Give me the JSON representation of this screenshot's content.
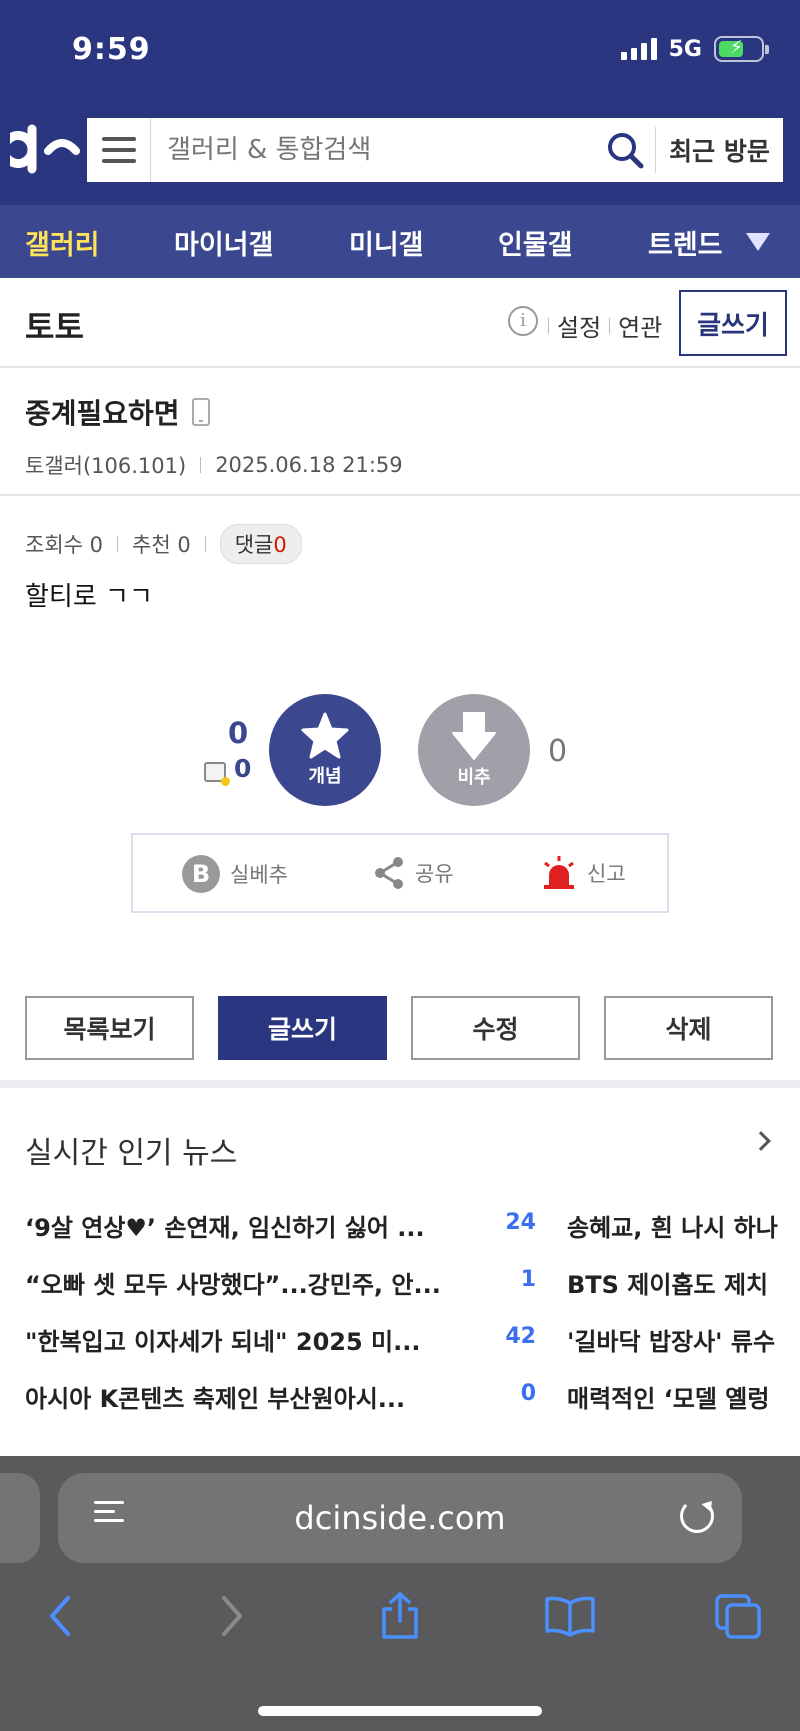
{
  "status": {
    "time": "9:59",
    "network": "5G"
  },
  "header": {
    "search_placeholder": "갤러리 & 통합검색",
    "recent_label": "최근 방문",
    "nav": [
      "갤러리",
      "마이너갤",
      "미니갤",
      "인물갤",
      "트렌드"
    ],
    "accent": "#2b3680",
    "active_color": "#ffe35a"
  },
  "gallery": {
    "name": "토토",
    "links": [
      "설정",
      "연관"
    ],
    "write_label": "글쓰기"
  },
  "post": {
    "title": "중계필요하면",
    "author": "토갤러(106.101)",
    "date": "2025.06.18 21:59",
    "views_label": "조회수 0",
    "recommend_label": "추천 0",
    "comment_label": "댓글",
    "comment_count": "0",
    "body": "할티로 ㄱㄱ"
  },
  "vote": {
    "up_count": "0",
    "fix_count": "0",
    "up_label": "개념",
    "down_label": "비추",
    "down_count": "0"
  },
  "actions": {
    "bestdown": "실베추",
    "share": "공유",
    "report": "신고"
  },
  "buttons": {
    "list": "목록보기",
    "write": "글쓰기",
    "edit": "수정",
    "delete": "삭제"
  },
  "news": {
    "title": "실시간 인기 뉴스",
    "items": [
      {
        "title": "‘9살 연상♥’ 손연재, 임신하기 싫어 ...",
        "count": "24",
        "right": "송혜교, 흰 나시 하나"
      },
      {
        "title": "“오빠 셋 모두 사망했다”...강민주, 안...",
        "count": "1",
        "right": "BTS 제이홉도 제치"
      },
      {
        "title": "\"한복입고 이자세가 되네\" 2025 미...",
        "count": "42",
        "right": "'길바닥 밥장사' 류수"
      },
      {
        "title": "아시아 K콘텐츠 축제인 부산원아시...",
        "count": "0",
        "right": "매력적인 ‘모델 옐렁"
      }
    ]
  },
  "browser": {
    "url": "dcinside.com"
  }
}
